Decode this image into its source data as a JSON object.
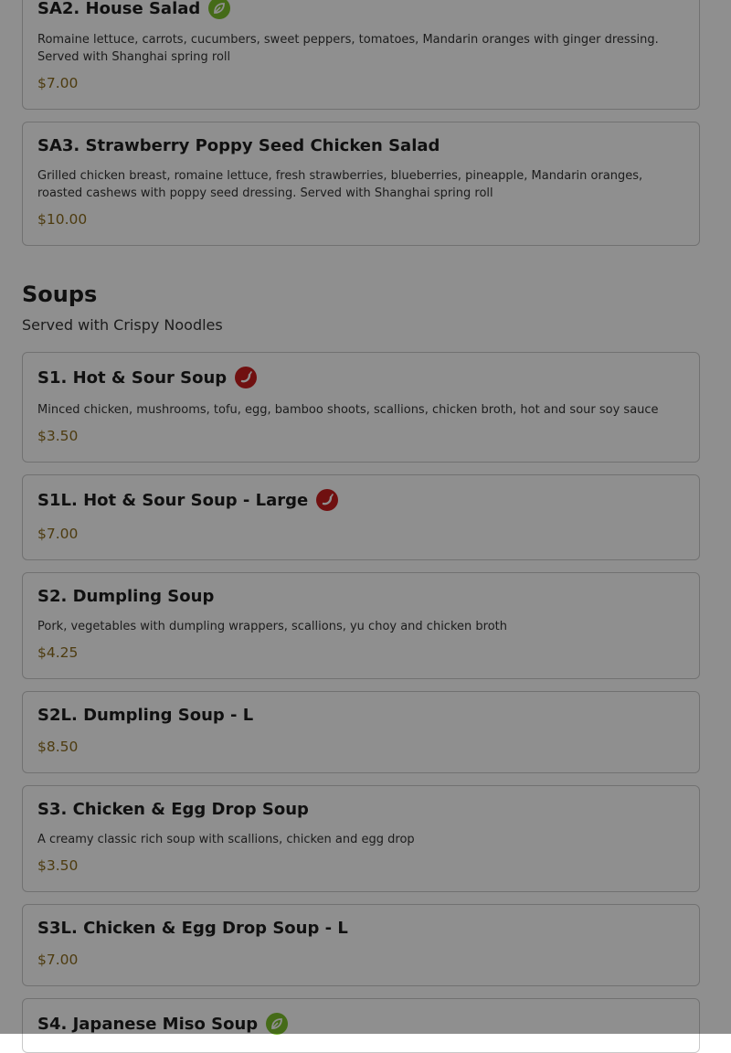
{
  "section": {
    "title": "Soups",
    "subtitle": "Served with Crispy Noodles"
  },
  "items": [
    {
      "name": "SA2. House Salad",
      "badge": "veg-leaf-icon",
      "description": "Romaine lettuce, carrots, cucumbers, sweet peppers, tomatoes, Mandarin oranges with ginger dressing. Served with Shanghai spring roll",
      "price": "$7.00"
    },
    {
      "name": "SA3. Strawberry Poppy Seed Chicken Salad",
      "badge": "",
      "description": "Grilled chicken breast, romaine lettuce, fresh strawberries, blueberries, pineapple, Mandarin oranges, roasted cashews with poppy seed dressing. Served with Shanghai spring roll",
      "price": "$10.00"
    },
    {
      "name": "S1. Hot & Sour Soup",
      "badge": "spicy-pepper-icon",
      "description": "Minced chicken, mushrooms, tofu, egg, bamboo shoots, scallions, chicken broth, hot and sour soy sauce",
      "price": "$3.50"
    },
    {
      "name": "S1L. Hot & Sour Soup - Large",
      "badge": "spicy-pepper-icon",
      "description": "",
      "price": "$7.00"
    },
    {
      "name": "S2. Dumpling Soup",
      "badge": "",
      "description": "Pork, vegetables with dumpling wrappers, scallions, yu choy and chicken broth",
      "price": "$4.25"
    },
    {
      "name": "S2L. Dumpling Soup - L",
      "badge": "",
      "description": "",
      "price": "$8.50"
    },
    {
      "name": "S3. Chicken & Egg Drop Soup",
      "badge": "",
      "description": "A creamy classic rich soup with scallions, chicken and egg drop",
      "price": "$3.50"
    },
    {
      "name": "S3L. Chicken & Egg Drop Soup - L",
      "badge": "",
      "description": "",
      "price": "$7.00"
    },
    {
      "name": "S4. Japanese Miso Soup",
      "badge": "veg-leaf-icon",
      "description": "",
      "price": ""
    }
  ],
  "colors": {
    "veg_badge": "#7bbf2c",
    "spicy_badge": "#c81e1e",
    "price": "#8a6a1c",
    "overlay": "rgba(0,0,0,0.44)"
  }
}
